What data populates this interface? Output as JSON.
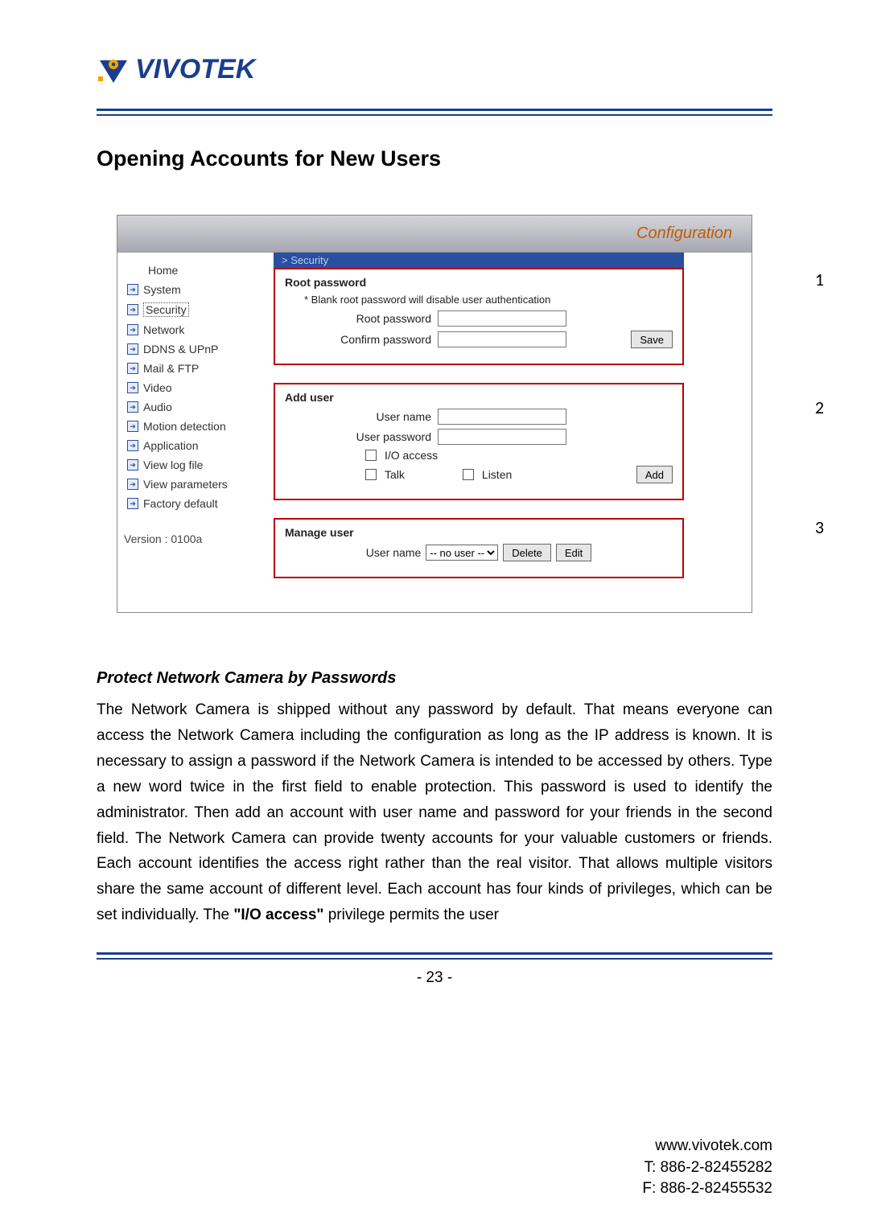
{
  "logo": {
    "text": "VIVOTEK"
  },
  "section_title": "Opening Accounts for New Users",
  "config": {
    "title": "Configuration",
    "breadcrumb": "> Security",
    "sidebar": {
      "home": "Home",
      "items": [
        "System",
        "Security",
        "Network",
        "DDNS & UPnP",
        "Mail & FTP",
        "Video",
        "Audio",
        "Motion detection",
        "Application",
        "View log file",
        "View parameters",
        "Factory default"
      ],
      "version": "Version : 0100a"
    },
    "root_panel": {
      "heading": "Root password",
      "note": "* Blank root password will disable user authentication",
      "root_label": "Root password",
      "confirm_label": "Confirm password",
      "save": "Save"
    },
    "add_panel": {
      "heading": "Add user",
      "user_label": "User name",
      "pass_label": "User password",
      "io_label": "I/O access",
      "talk_label": "Talk",
      "listen_label": "Listen",
      "add": "Add"
    },
    "manage_panel": {
      "heading": "Manage user",
      "user_label": "User name",
      "option": "-- no user --",
      "delete": "Delete",
      "edit": "Edit"
    },
    "numbers": [
      "1",
      "2",
      "3"
    ]
  },
  "subhead": "Protect Network Camera by Passwords",
  "para_pre": "The Network Camera is shipped without any password by default. That means everyone can access the Network Camera including the configuration as long as the IP address is known. It is necessary to assign a password if the Network Camera is intended to be accessed by others. Type a new word twice in the first field to enable protection. This password is used to identify the administrator. Then add an account with user name and password for your friends in the second field. The Network Camera can provide twenty accounts for your valuable customers or friends. Each account identifies the access right rather than the real visitor. That allows multiple visitors share the same account of different level. Each account has four kinds of privileges, which can be set individually. The ",
  "para_bold": "\"I/O access\"",
  "para_post": " privilege permits the user",
  "page_number": "- 23 -",
  "footer": {
    "url": "www.vivotek.com",
    "tel": "T: 886-2-82455282",
    "fax": "F: 886-2-82455532"
  }
}
